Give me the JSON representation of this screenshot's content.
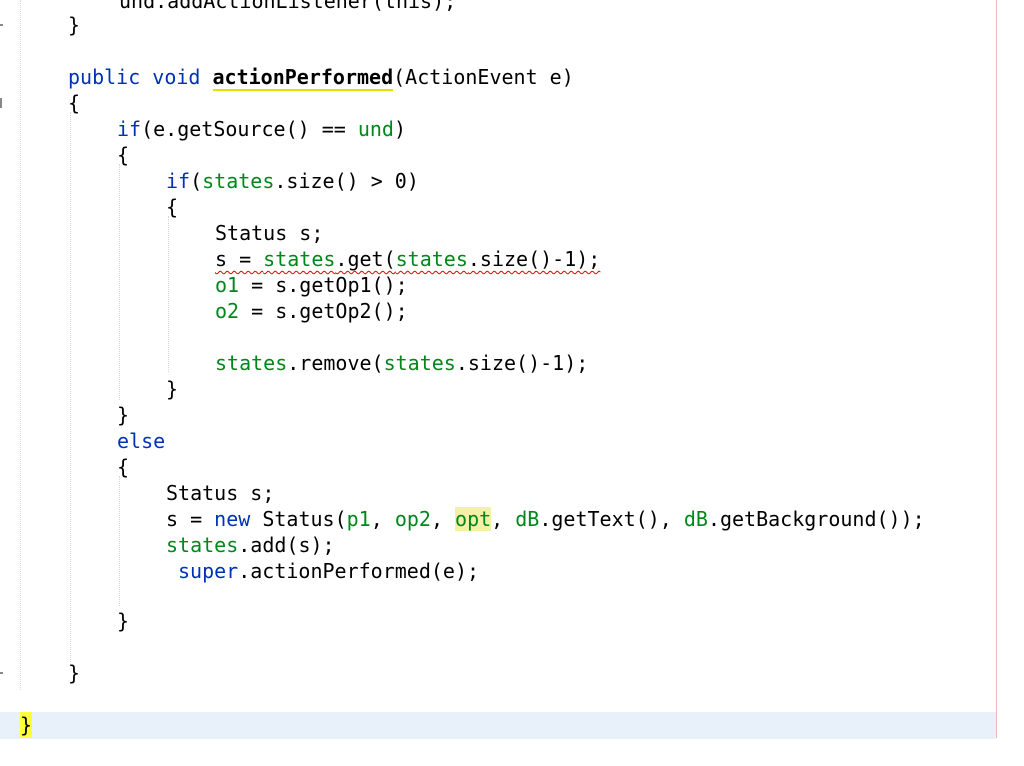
{
  "editor": {
    "lines": {
      "l0": {
        "text": "und.addActionListener(this);"
      },
      "l1": {
        "text": "}"
      },
      "l3": {
        "kw1": "public",
        "kw2": "void",
        "method": "actionPerformed",
        "rest": "(ActionEvent e)"
      },
      "l4": {
        "text": "{"
      },
      "l5": {
        "kw": "if",
        "a": "(e.getSource() == ",
        "fld": "und",
        "b": ")"
      },
      "l6": {
        "text": "{"
      },
      "l7": {
        "kw": "if",
        "a": "(",
        "fld": "states",
        "b": ".size() > 0)"
      },
      "l8": {
        "text": "{"
      },
      "l9": {
        "text": "Status s;"
      },
      "l10": {
        "a": "s = ",
        "fld1": "states",
        "b": ".get(",
        "fld2": "states",
        "c": ".size()-1);"
      },
      "l11": {
        "fld": "o1",
        "rest": " = s.getOp1();"
      },
      "l12": {
        "fld": "o2",
        "rest": " = s.getOp2();"
      },
      "l14": {
        "fld1": "states",
        "a": ".remove(",
        "fld2": "states",
        "b": ".size()-1);"
      },
      "l15": {
        "text": "}"
      },
      "l16": {
        "text": "}"
      },
      "l17": {
        "kw": "else"
      },
      "l18": {
        "text": "{"
      },
      "l19": {
        "text": "Status s;"
      },
      "l20": {
        "a": "s = ",
        "kw": "new",
        "b": " Status(",
        "p1": "p1",
        "c": ", ",
        "op2": "op2",
        "d": ", ",
        "opt": "opt",
        "e": ", ",
        "dB1": "dB",
        "f": ".getText(), ",
        "dB2": "dB",
        "g": ".getBackground());"
      },
      "l21": {
        "fld": "states",
        "rest": ".add(s);"
      },
      "l22": {
        "kw": "super",
        "rest": ".actionPerformed(e);"
      },
      "l24": {
        "text": "}"
      },
      "l26": {
        "text": "}"
      },
      "l28": {
        "text": "}"
      }
    }
  }
}
